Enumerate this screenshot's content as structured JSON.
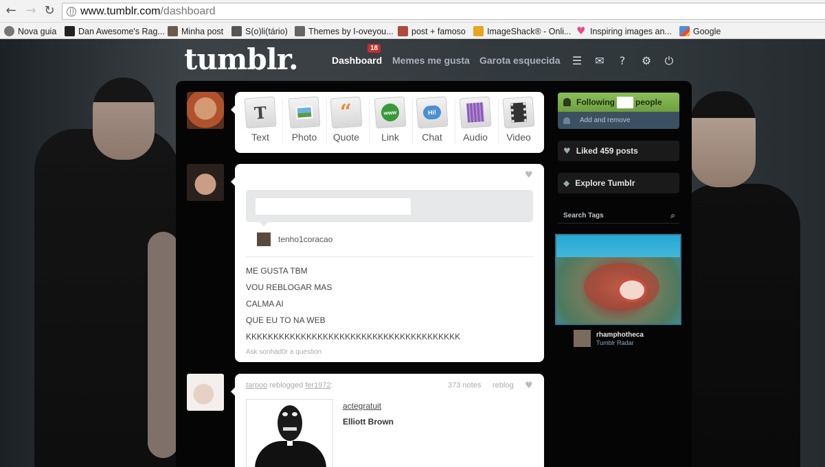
{
  "browser": {
    "url_host": "www.tumblr.com",
    "url_path": "/dashboard",
    "bookmarks": [
      {
        "label": "Nova guia",
        "icon": "new-tab-icon",
        "color": "#777777"
      },
      {
        "label": "Dan Awesome's Rag...",
        "icon": "dan-awesome-icon",
        "color": "#222222"
      },
      {
        "label": "Minha post",
        "icon": "minha-post-icon",
        "color": "#6b5a4a"
      },
      {
        "label": "S(o)li(tário)",
        "icon": "solitario-icon",
        "color": "#555555"
      },
      {
        "label": "Themes by I-oveyou...",
        "icon": "themes-icon",
        "color": "#666666"
      },
      {
        "label": "post + famoso",
        "icon": "post-famoso-icon",
        "color": "#b04a3a"
      },
      {
        "label": "ImageShack® - Onli...",
        "icon": "imageshack-icon",
        "color": "#e6a421"
      },
      {
        "label": "Inspiring images an...",
        "icon": "heart-icon",
        "color": "#e84a8a"
      },
      {
        "label": "Google",
        "icon": "google-icon",
        "color": "#4a90d9"
      }
    ]
  },
  "header": {
    "logo": "tumblr.",
    "nav": [
      {
        "label": "Dashboard",
        "active": true
      },
      {
        "label": "Memes me gusta",
        "active": false
      },
      {
        "label": "Garota esquecida",
        "active": false
      }
    ],
    "badge": "18",
    "icons": [
      "list-icon",
      "mail-icon",
      "help-icon",
      "settings-icon",
      "power-icon"
    ]
  },
  "post_types": [
    {
      "label": "Text",
      "glyph": "T",
      "color": "#444444"
    },
    {
      "label": "Photo",
      "glyph": "▣",
      "color": "#4e88c7"
    },
    {
      "label": "Quote",
      "glyph": "❝",
      "color": "#e38b32"
    },
    {
      "label": "Link",
      "glyph": "www",
      "color": "#3a9a3a"
    },
    {
      "label": "Chat",
      "glyph": "Hi!",
      "color": "#4c8fd1"
    },
    {
      "label": "Audio",
      "glyph": "▦",
      "color": "#8a5bb5"
    },
    {
      "label": "Video",
      "glyph": "▦",
      "color": "#333333"
    }
  ],
  "post1": {
    "source_user": "tenho1coracao",
    "lines": [
      "ME GUSTA TBM",
      "VOU REBLOGAR MAS",
      "CALMA AI",
      "QUE EU TO NA WEB",
      "KKKKKKKKKKKKKKKKKKKKKKKKKKKKKKKKKKKKKKK"
    ],
    "ask": "Ask sonhad0r a question"
  },
  "post2": {
    "user": "tarpoo",
    "action": " reblogged ",
    "from": "fer1972",
    "colon": ":",
    "notes": "373 notes",
    "reblog": "reblog",
    "quote_user": "actegratuit",
    "title": "Elliott Brown"
  },
  "sidebar": {
    "following_prefix": "Following",
    "following_suffix": "people",
    "add_remove": "Add and remove",
    "liked": "Liked 459 posts",
    "explore": "Explore Tumblr",
    "search_tags": "Search Tags",
    "radar_user": "rhamphotheca",
    "radar_label": "Tumblr Radar"
  }
}
